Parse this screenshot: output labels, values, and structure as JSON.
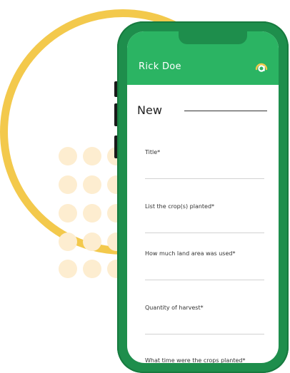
{
  "app_bar": {
    "user_name": "Rick Doe",
    "logo_icon": "app-logo-icon",
    "color": "#2bb463",
    "logo_colors": [
      "#f3c94c",
      "#ffffff"
    ]
  },
  "form": {
    "title": "New",
    "fields": [
      {
        "label": "Title*",
        "value": ""
      },
      {
        "label": "List the crop(s) planted*",
        "value": ""
      },
      {
        "label": "How much land area was used*",
        "value": ""
      },
      {
        "label": "Quantity of harvest*",
        "value": ""
      },
      {
        "label": "What time were the crops planted*",
        "value": ""
      }
    ]
  },
  "decor": {
    "ring_color": "#f3c94c",
    "dot_color": "#fdedd0",
    "phone_color": "#1e8e4c"
  }
}
